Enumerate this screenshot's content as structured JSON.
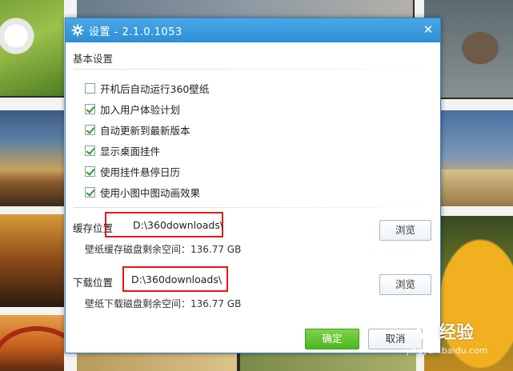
{
  "dialog": {
    "title": "设置 - 2.1.0.1053",
    "close_glyph": "✕"
  },
  "basic": {
    "section_title": "基本设置",
    "options": [
      {
        "label": "开机后自动运行360壁纸",
        "checked": false
      },
      {
        "label": "加入用户体验计划",
        "checked": true
      },
      {
        "label": "自动更新到最新版本",
        "checked": true
      },
      {
        "label": "显示桌面挂件",
        "checked": true
      },
      {
        "label": "使用挂件悬停日历",
        "checked": true
      },
      {
        "label": "使用小图中图动画效果",
        "checked": true
      }
    ]
  },
  "cache": {
    "label": "缓存位置",
    "path": "D:\\360downloads\\",
    "browse_label": "浏览",
    "space_text": "壁纸缓存磁盘剩余空间：136.77 GB"
  },
  "download": {
    "label": "下载位置",
    "path": "D:\\360downloads\\",
    "browse_label": "浏览",
    "space_text": "壁纸下载磁盘剩余空间：136.77 GB"
  },
  "footer": {
    "ok_label": "确定",
    "cancel_label": "取消"
  },
  "watermark": {
    "text": "经验",
    "url": "jingyan.baidu.com"
  },
  "colors": {
    "title_bar": "#2d8fd6",
    "ok_button": "#4bb81e",
    "highlight_box": "#e01818",
    "checkmark": "#2a9a2a"
  },
  "icons": {
    "title": "gear-icon",
    "close": "close-icon",
    "watermark": "baidu-paw-icon"
  }
}
